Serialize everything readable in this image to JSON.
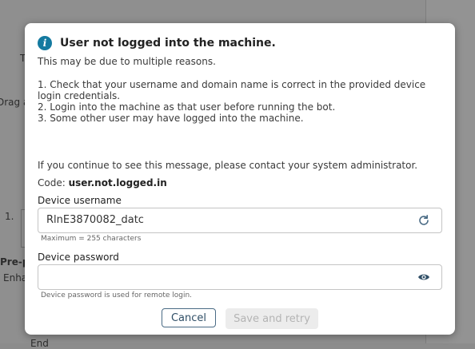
{
  "background": {
    "fragments": [
      "T",
      "Drag a",
      "1.",
      "Pre-p",
      "Enha",
      "End"
    ]
  },
  "dialog": {
    "title": "User not logged into the machine.",
    "subtitle": "This may be due to multiple reasons.",
    "reasons": [
      "1. Check that your username and domain name is correct in the provided device login credentials.",
      "2. Login into the machine as that user before running the bot.",
      "3. Some other user may have logged into the machine."
    ],
    "contact_message": "If you continue to see this message, please contact your system administrator.",
    "code_label": "Code:",
    "code_value": "user.not.logged.in",
    "username": {
      "label": "Device username",
      "value": "RlnE3870082_datc",
      "hint": "Maximum = 255 characters",
      "icon": "refresh-icon"
    },
    "password": {
      "label": "Device password",
      "value": "",
      "hint": "Device password is used for remote login.",
      "icon": "eye-icon"
    },
    "buttons": {
      "cancel": "Cancel",
      "save_retry": "Save and retry"
    },
    "accent_color": "#147aa0"
  }
}
